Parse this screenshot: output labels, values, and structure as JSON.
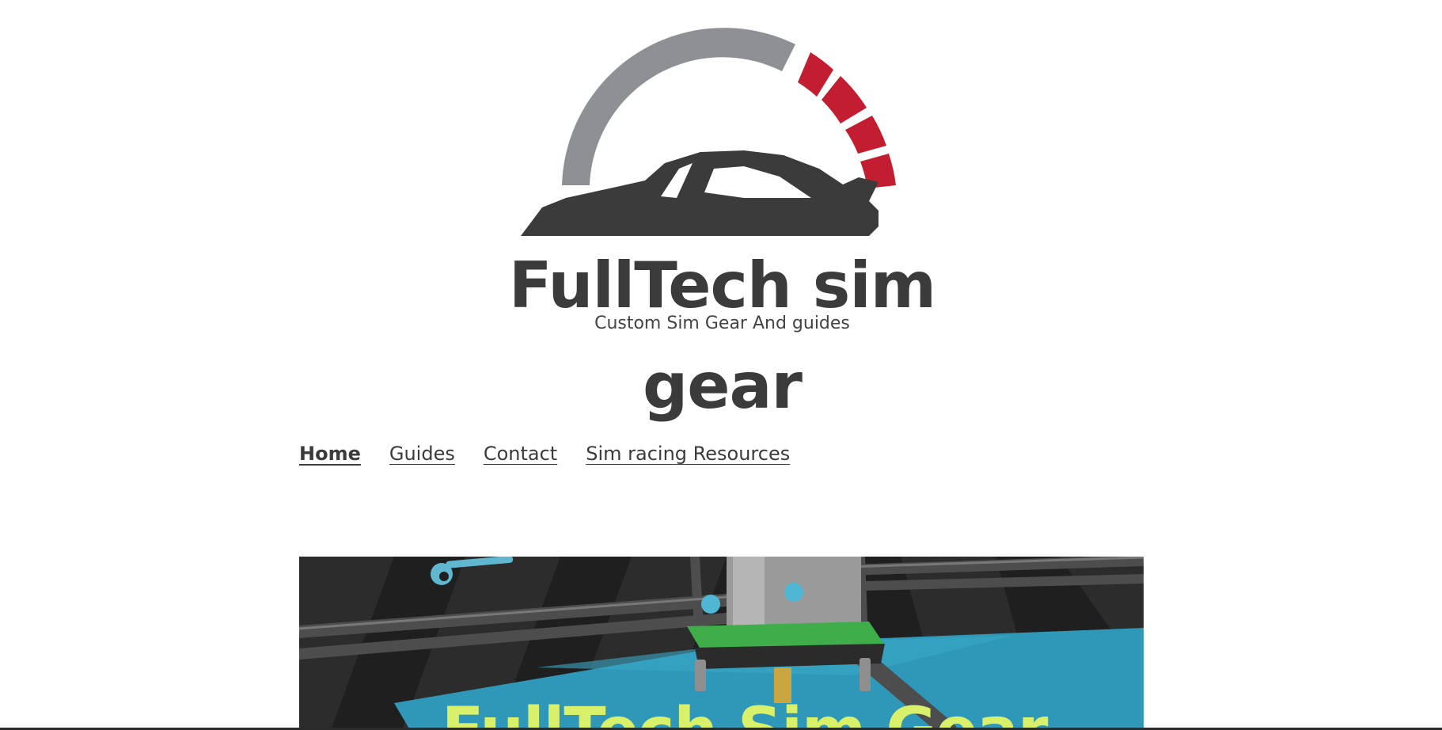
{
  "logo": {
    "line1": "FullTech sim",
    "tagline": "Custom Sim Gear And guides",
    "line3": "gear",
    "colors": {
      "gauge_grey": "#8e9094",
      "gauge_red": "#c21d30",
      "car": "#3b3b3b"
    }
  },
  "nav": {
    "items": [
      {
        "label": "Home",
        "active": true
      },
      {
        "label": "Guides",
        "active": false
      },
      {
        "label": "Contact",
        "active": false
      },
      {
        "label": "Sim racing Resources",
        "active": false
      }
    ]
  },
  "hero": {
    "title": "FullTech Sim Gear",
    "colors": {
      "background": "#1f1f1f",
      "bed": "#2f98b8",
      "carriage": "#3fae4a",
      "wrench": "#5fb8cf"
    }
  }
}
